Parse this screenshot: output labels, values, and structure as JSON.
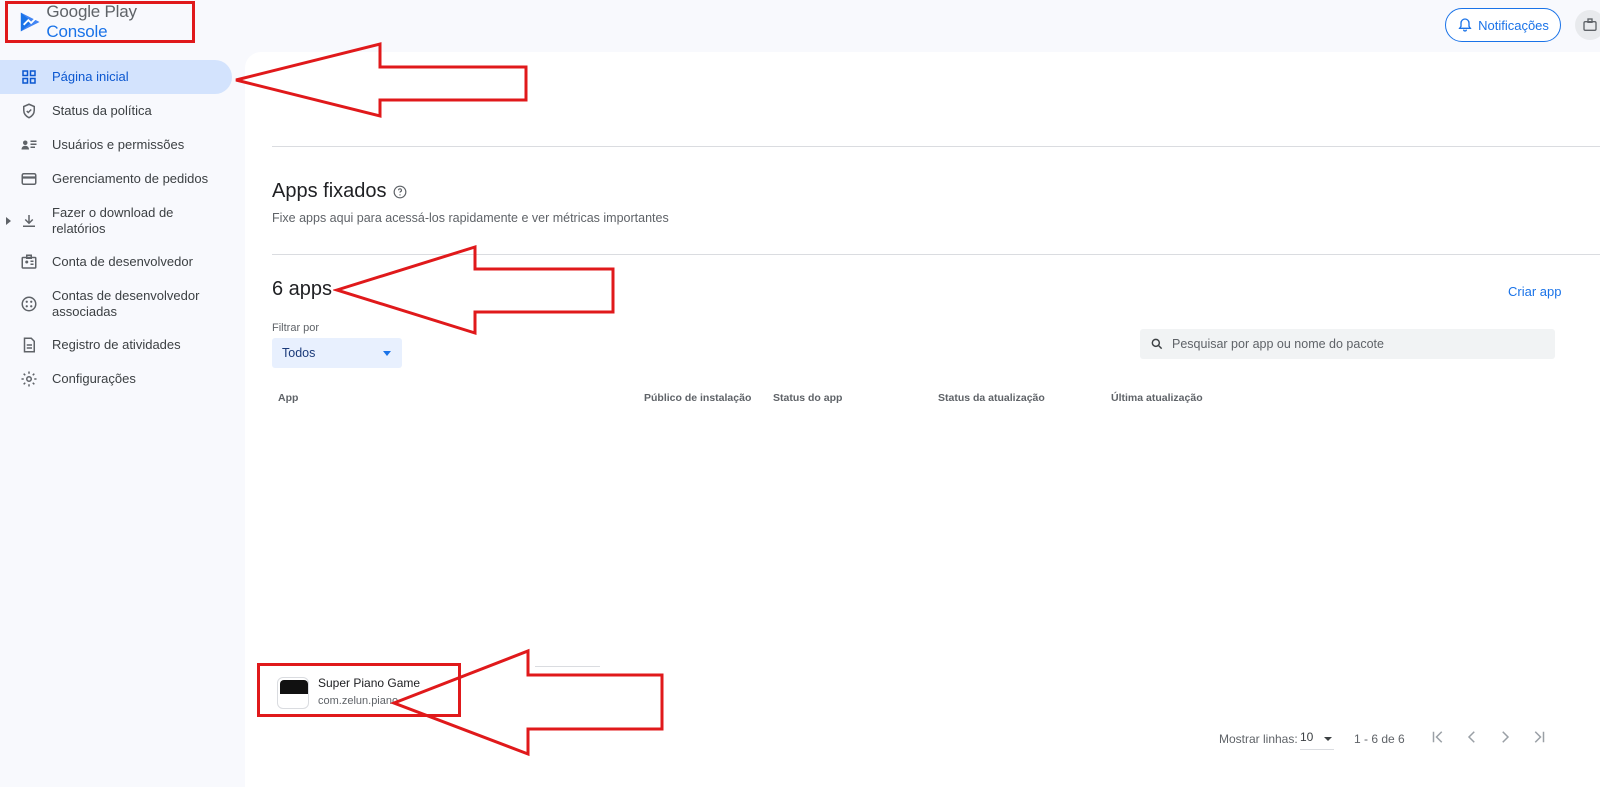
{
  "header": {
    "brand_google": "Google Play",
    "brand_console": "Console",
    "notifications_label": "Notificações"
  },
  "sidebar": {
    "items": [
      {
        "label": "Página inicial",
        "icon": "dashboard-icon",
        "active": true
      },
      {
        "label": "Status da política",
        "icon": "shield-icon"
      },
      {
        "label": "Usuários e permissões",
        "icon": "users-list-icon"
      },
      {
        "label": "Gerenciamento de pedidos",
        "icon": "credit-card-icon"
      },
      {
        "label": "Fazer o download de relatórios",
        "icon": "download-icon",
        "expandable": true
      },
      {
        "label": "Conta de desenvolvedor",
        "icon": "id-badge-icon"
      },
      {
        "label": "Contas de desenvolvedor associadas",
        "icon": "linked-accounts-icon"
      },
      {
        "label": "Registro de atividades",
        "icon": "document-icon"
      },
      {
        "label": "Configurações",
        "icon": "gear-icon"
      }
    ]
  },
  "pinned": {
    "title": "Apps fixados",
    "subtitle": "Fixe apps aqui para acessá-los rapidamente e ver métricas importantes"
  },
  "apps": {
    "count_title": "6 apps",
    "create_label": "Criar app",
    "filter_label": "Filtrar por",
    "filter_value": "Todos",
    "search_placeholder": "Pesquisar por app ou nome do pacote",
    "columns": [
      "App",
      "Público de instalação",
      "Status do app",
      "Status da atualização",
      "Última atualização"
    ],
    "rows": [
      {
        "name": "Super Piano Game",
        "package": "com.zelun.piano"
      }
    ]
  },
  "pagination": {
    "rows_label": "Mostrar linhas:",
    "rows_value": "10",
    "range": "1 - 6 de 6"
  },
  "colors": {
    "accent": "#1a73e8",
    "annotation": "#e0191b",
    "active_nav": "#d3e3fd"
  }
}
